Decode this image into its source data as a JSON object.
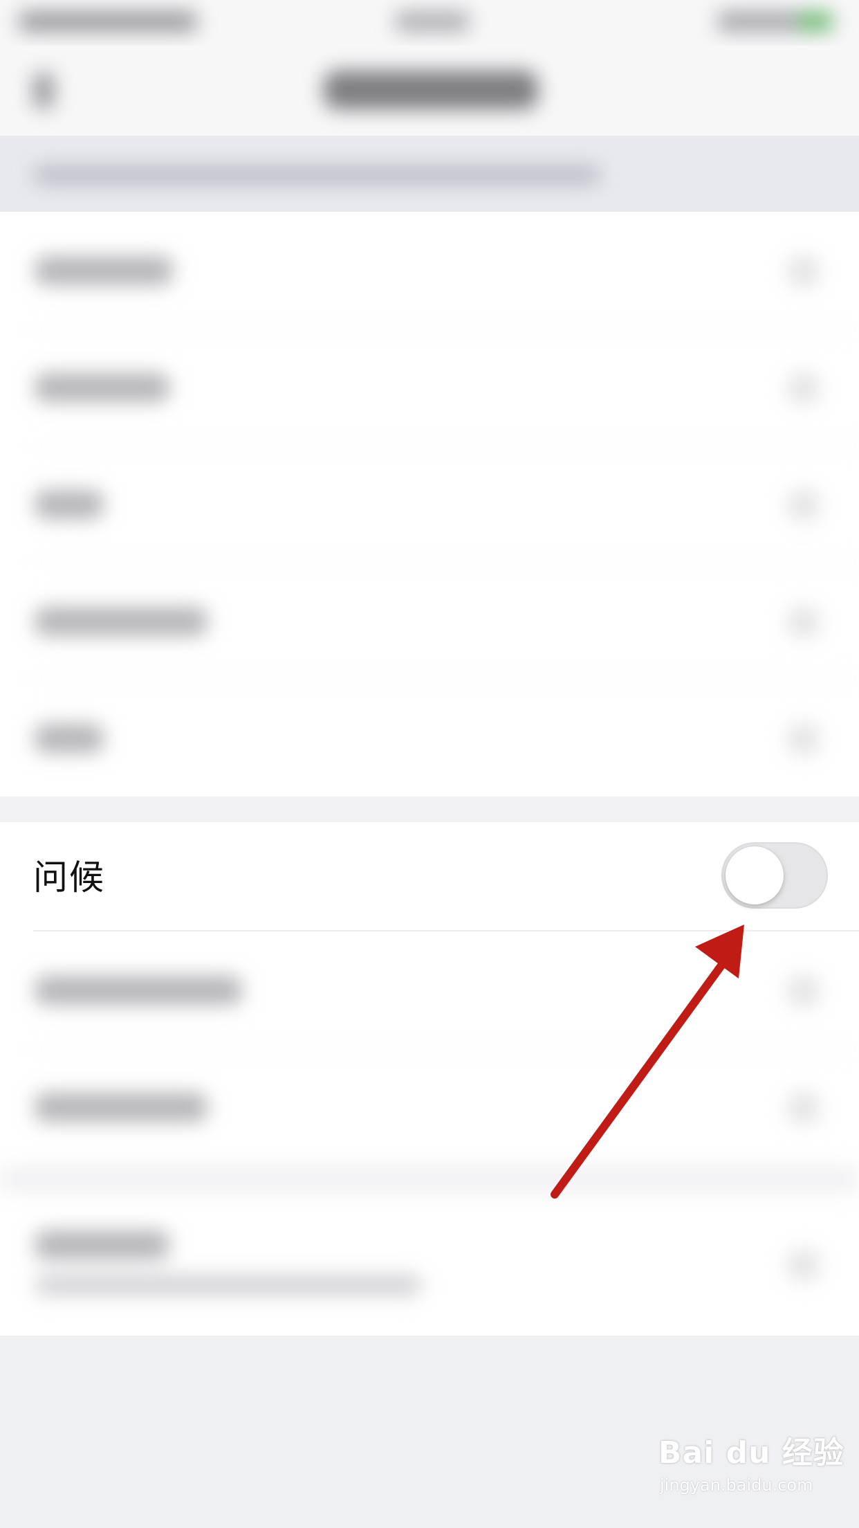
{
  "settings": {
    "greeting_row": {
      "label": "问候",
      "toggle_on": false
    }
  },
  "colors": {
    "page_background": "#f2f2f5",
    "toggle_track_off": "#e6e6e9",
    "annotation_arrow": "#c01b14"
  },
  "watermark": {
    "logo_text": "Bai du 经验",
    "url": "jingyan.baidu.com"
  }
}
